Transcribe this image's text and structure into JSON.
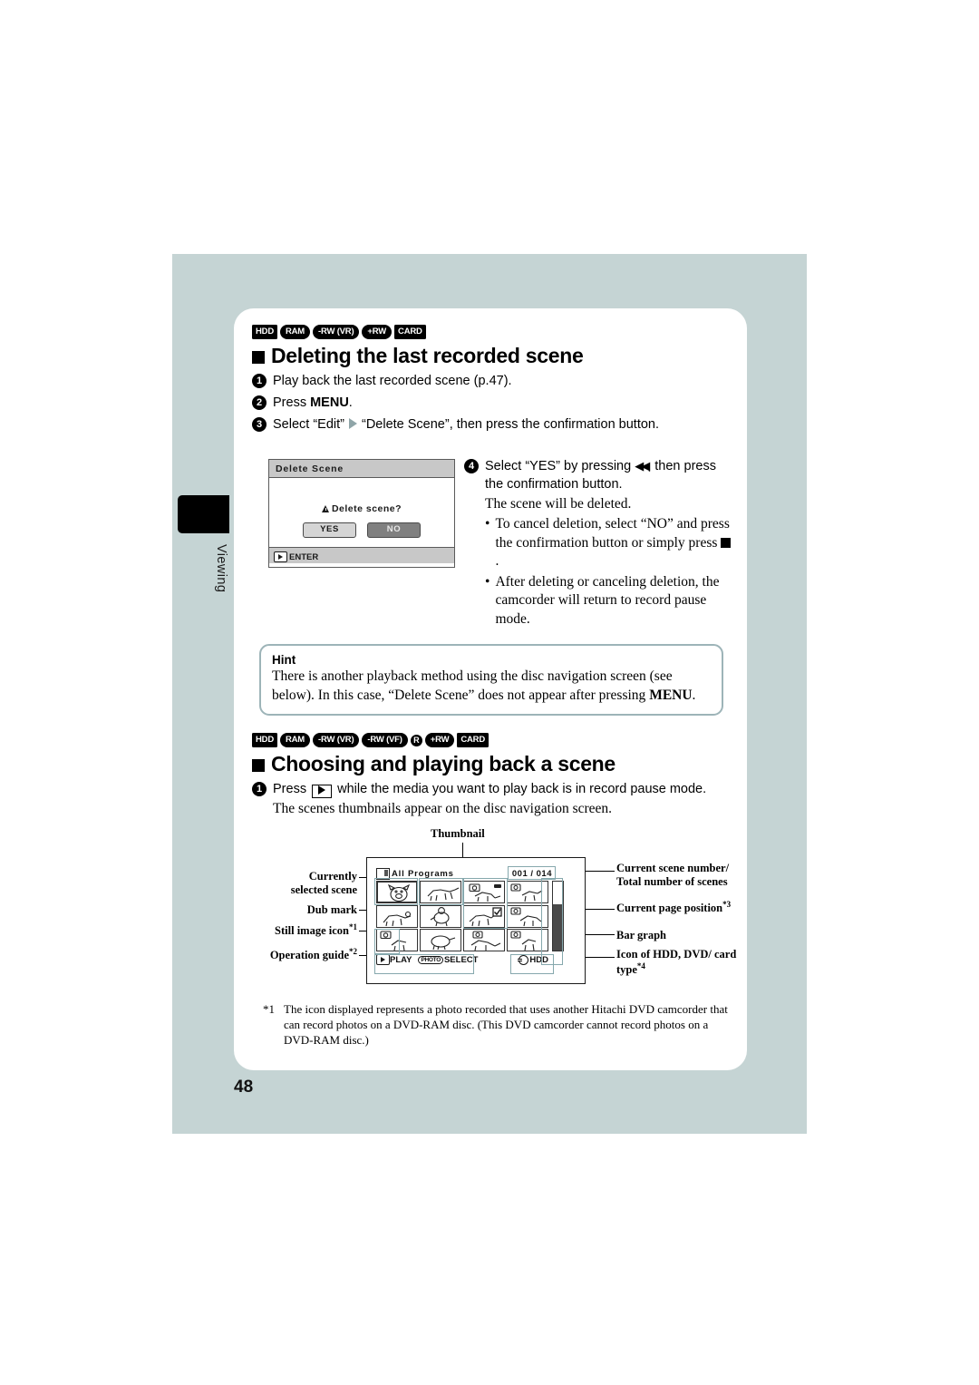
{
  "page": {
    "number": "48",
    "side_tab_label": "Viewing",
    "bg_color": "#c5d4d4",
    "accent_color": "#86a8ad"
  },
  "section1": {
    "badges": [
      {
        "text": "HDD",
        "shape": "rect"
      },
      {
        "text": "RAM",
        "shape": "pill"
      },
      {
        "text": "-RW (VR)",
        "shape": "pill"
      },
      {
        "text": "+RW",
        "shape": "pill"
      },
      {
        "text": "CARD",
        "shape": "rect"
      }
    ],
    "title": "Deleting the last recorded scene",
    "steps": [
      {
        "num": "1",
        "text": "Play back the last recorded scene (p.47)."
      },
      {
        "num": "2",
        "text_before": "Press ",
        "bold": "MENU",
        "text_after": "."
      },
      {
        "num": "3",
        "text_before": "Select “Edit”",
        "text_after": "“Delete Scene”, then press the confirmation button."
      }
    ],
    "step4": {
      "num": "4",
      "line1_a": "Select “YES” by pressing ",
      "line1_b": ", then press the confirmation button.",
      "result": "The scene will be deleted.",
      "bullets": [
        {
          "a": "To cancel deletion, select “NO” and press the confirmation button or simply press ",
          "b": "."
        },
        {
          "a": "After deleting or canceling deletion, the camcorder will return to record pause mode.",
          "b": ""
        }
      ]
    },
    "dialog": {
      "title": "Delete  Scene",
      "question": "Delete  scene?",
      "yes_label": "YES",
      "no_label": "NO",
      "footer_label": "ENTER"
    }
  },
  "hint": {
    "title": "Hint",
    "body_a": "There is another playback method using the disc navigation screen (see below). In this case, “Delete Scene” does not appear after pressing ",
    "body_bold": "MENU",
    "body_b": "."
  },
  "section2": {
    "badges": [
      {
        "text": "HDD",
        "shape": "rect"
      },
      {
        "text": "RAM",
        "shape": "pill"
      },
      {
        "text": "-RW (VR)",
        "shape": "pill"
      },
      {
        "text": "-RW (VF)",
        "shape": "pill"
      },
      {
        "text": "R",
        "shape": "circle"
      },
      {
        "text": "+RW",
        "shape": "pill"
      },
      {
        "text": "CARD",
        "shape": "rect"
      }
    ],
    "title": "Choosing and playing back a scene",
    "step1": {
      "num": "1",
      "a": "Press ",
      "b": " while the media you want to play back is in record pause mode."
    },
    "step1_sub": "The scenes thumbnails appear on the disc navigation screen."
  },
  "diagram": {
    "callouts": {
      "thumbnail": "Thumbnail",
      "currently_selected_scene": "Currently\nselected scene",
      "dub_mark": "Dub mark",
      "still_image_icon": "Still image icon",
      "still_image_icon_sup": "*1",
      "operation_guide": "Operation guide",
      "operation_guide_sup": "*2",
      "current_scene_number": "Current scene number/\nTotal number of scenes",
      "current_page_position": "Current page position",
      "current_page_position_sup": "*3",
      "bar_graph": "Bar graph",
      "icon_of_type": "Icon of HDD, DVD/ card type",
      "icon_of_type_sup": "*4"
    },
    "screen": {
      "program_label": "All  Programs",
      "scene_count": "001 / 014",
      "guide_play": "PLAY",
      "guide_photo_badge": "PHOTO",
      "guide_select": "SELECT",
      "media_label": "HDD"
    }
  },
  "footnote": {
    "mark": "*1",
    "text": "The icon displayed represents a photo recorded that uses another Hitachi DVD camcorder that can record photos on a DVD-RAM disc. (This DVD camcorder cannot record photos on a DVD-RAM disc.)"
  }
}
